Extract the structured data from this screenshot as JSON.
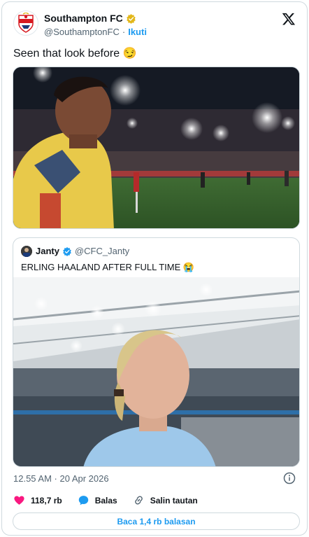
{
  "author": {
    "display_name": "Southampton FC",
    "handle": "@SouthamptonFC",
    "separator": "·",
    "follow_label": "Ikuti"
  },
  "tweet": {
    "text": "Seen that look before 😏",
    "timestamp": "12.55 AM · 20 Apr 2026"
  },
  "quote": {
    "display_name": "Janty",
    "handle": "@CFC_Janty",
    "text": "ERLING HAALAND AFTER FULL TIME 😭"
  },
  "actions": {
    "likes": "118,7 rb",
    "reply_label": "Balas",
    "copy_label": "Salin tautan"
  },
  "read_replies_label": "Baca 1,4 rb balasan",
  "colors": {
    "accent": "#1d9bf0",
    "like": "#f91880",
    "verified_gold": "#e2b719",
    "southampton_red": "#d71920"
  },
  "icons": [
    "southampton-crest-icon",
    "verified-gold-icon",
    "x-logo-icon",
    "verified-blue-icon",
    "info-icon",
    "heart-icon",
    "reply-bubble-icon",
    "link-icon"
  ]
}
